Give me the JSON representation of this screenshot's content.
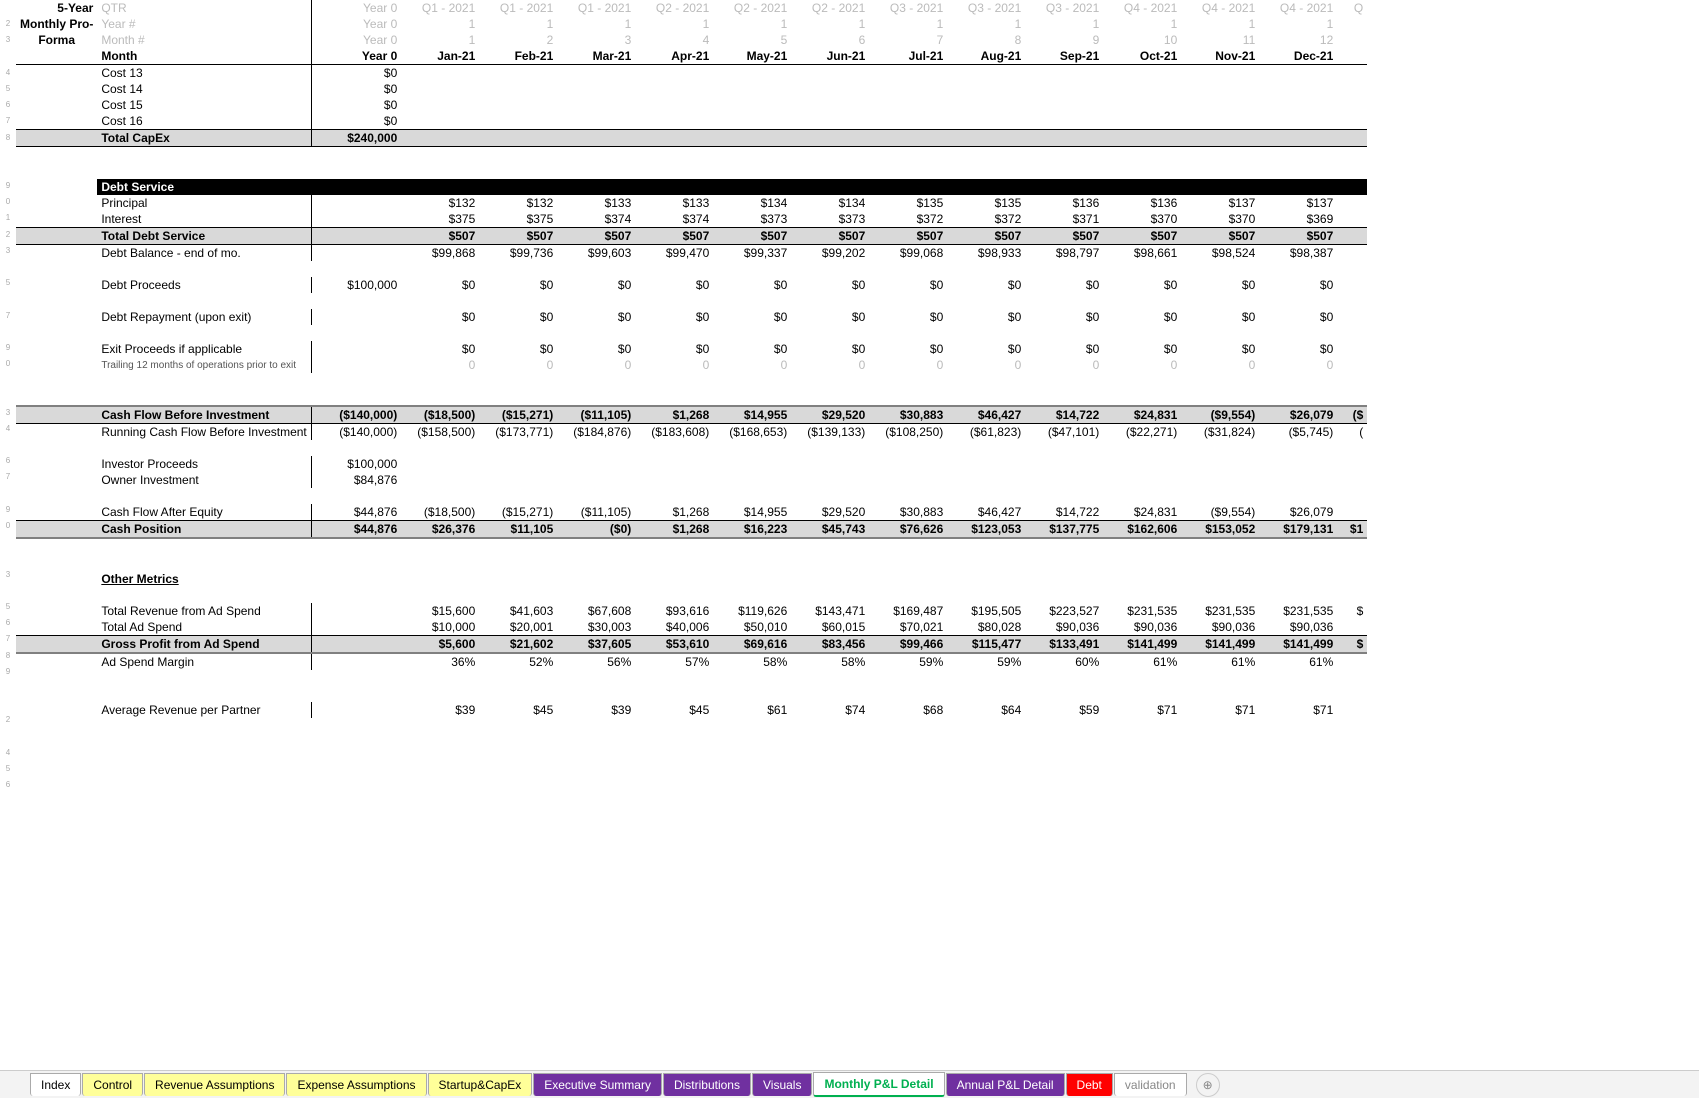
{
  "header": {
    "title_a": "5-Year",
    "title_b1": "Monthly Pro-",
    "title_b2": "Forma",
    "qtr_label": "QTR",
    "year_num_label": "Year #",
    "month_num_label": "Month #",
    "month_label": "Month",
    "year0": "Year 0",
    "quarters": [
      "Q1 - 2021",
      "Q1 - 2021",
      "Q1 - 2021",
      "Q2 - 2021",
      "Q2 - 2021",
      "Q2 - 2021",
      "Q3 - 2021",
      "Q3 - 2021",
      "Q3 - 2021",
      "Q4 - 2021",
      "Q4 - 2021",
      "Q4 - 2021",
      "Q"
    ],
    "year_nums": [
      "1",
      "1",
      "1",
      "1",
      "1",
      "1",
      "1",
      "1",
      "1",
      "1",
      "1",
      "1"
    ],
    "month_nums": [
      "1",
      "2",
      "3",
      "4",
      "5",
      "6",
      "7",
      "8",
      "9",
      "10",
      "11",
      "12"
    ],
    "months": [
      "Jan-21",
      "Feb-21",
      "Mar-21",
      "Apr-21",
      "May-21",
      "Jun-21",
      "Jul-21",
      "Aug-21",
      "Sep-21",
      "Oct-21",
      "Nov-21",
      "Dec-21"
    ]
  },
  "costs": {
    "c13": {
      "label": "Cost 13",
      "val": "$0"
    },
    "c14": {
      "label": "Cost 14",
      "val": "$0"
    },
    "c15": {
      "label": "Cost 15",
      "val": "$0"
    },
    "c16": {
      "label": "Cost 16",
      "val": "$0"
    },
    "total": {
      "label": "Total CapEx",
      "val": "$240,000"
    }
  },
  "debt": {
    "section": "Debt Service",
    "principal": {
      "label": "Principal",
      "vals": [
        "$132",
        "$132",
        "$133",
        "$133",
        "$134",
        "$134",
        "$135",
        "$135",
        "$136",
        "$136",
        "$137",
        "$137"
      ]
    },
    "interest": {
      "label": "Interest",
      "vals": [
        "$375",
        "$375",
        "$374",
        "$374",
        "$373",
        "$373",
        "$372",
        "$372",
        "$371",
        "$370",
        "$370",
        "$369"
      ]
    },
    "total": {
      "label": "Total Debt Service",
      "vals": [
        "$507",
        "$507",
        "$507",
        "$507",
        "$507",
        "$507",
        "$507",
        "$507",
        "$507",
        "$507",
        "$507",
        "$507"
      ]
    },
    "balance": {
      "label": "Debt Balance - end of mo.",
      "vals": [
        "$99,868",
        "$99,736",
        "$99,603",
        "$99,470",
        "$99,337",
        "$99,202",
        "$99,068",
        "$98,933",
        "$98,797",
        "$98,661",
        "$98,524",
        "$98,387"
      ]
    },
    "proceeds": {
      "label": "Debt Proceeds",
      "y0": "$100,000",
      "vals": [
        "$0",
        "$0",
        "$0",
        "$0",
        "$0",
        "$0",
        "$0",
        "$0",
        "$0",
        "$0",
        "$0",
        "$0"
      ]
    },
    "repay": {
      "label": "Debt Repayment (upon exit)",
      "vals": [
        "$0",
        "$0",
        "$0",
        "$0",
        "$0",
        "$0",
        "$0",
        "$0",
        "$0",
        "$0",
        "$0",
        "$0"
      ]
    },
    "exit": {
      "label": "Exit Proceeds if applicable",
      "vals": [
        "$0",
        "$0",
        "$0",
        "$0",
        "$0",
        "$0",
        "$0",
        "$0",
        "$0",
        "$0",
        "$0",
        "$0"
      ]
    },
    "trailing": {
      "label": "Trailing 12 months of operations prior to exit",
      "vals": [
        "0",
        "0",
        "0",
        "0",
        "0",
        "0",
        "0",
        "0",
        "0",
        "0",
        "0",
        "0"
      ]
    }
  },
  "cashflow": {
    "before": {
      "label": "Cash Flow Before Investment",
      "y0": "($140,000)",
      "vals": [
        "($18,500)",
        "($15,271)",
        "($11,105)",
        "$1,268",
        "$14,955",
        "$29,520",
        "$30,883",
        "$46,427",
        "$14,722",
        "$24,831",
        "($9,554)",
        "$26,079",
        "($"
      ]
    },
    "running": {
      "label": "Running Cash Flow Before Investment",
      "y0": "($140,000)",
      "vals": [
        "($158,500)",
        "($173,771)",
        "($184,876)",
        "($183,608)",
        "($168,653)",
        "($139,133)",
        "($108,250)",
        "($61,823)",
        "($47,101)",
        "($22,271)",
        "($31,824)",
        "($5,745)",
        "("
      ]
    },
    "investor": {
      "label": "Investor Proceeds",
      "y0": "$100,000"
    },
    "owner": {
      "label": "Owner Investment",
      "y0": "$84,876"
    },
    "after": {
      "label": "Cash Flow After Equity",
      "y0": "$44,876",
      "vals": [
        "($18,500)",
        "($15,271)",
        "($11,105)",
        "$1,268",
        "$14,955",
        "$29,520",
        "$30,883",
        "$46,427",
        "$14,722",
        "$24,831",
        "($9,554)",
        "$26,079"
      ]
    },
    "position": {
      "label": "Cash Position",
      "y0": "$44,876",
      "vals": [
        "$26,376",
        "$11,105",
        "($0)",
        "$1,268",
        "$16,223",
        "$45,743",
        "$76,626",
        "$123,053",
        "$137,775",
        "$162,606",
        "$153,052",
        "$179,131",
        "$1"
      ]
    }
  },
  "metrics": {
    "section": "Other Metrics",
    "rev": {
      "label": "Total Revenue from Ad Spend",
      "vals": [
        "$15,600",
        "$41,603",
        "$67,608",
        "$93,616",
        "$119,626",
        "$143,471",
        "$169,487",
        "$195,505",
        "$223,527",
        "$231,535",
        "$231,535",
        "$231,535",
        "$"
      ]
    },
    "spend": {
      "label": "Total Ad Spend",
      "vals": [
        "$10,000",
        "$20,001",
        "$30,003",
        "$40,006",
        "$50,010",
        "$60,015",
        "$70,021",
        "$80,028",
        "$90,036",
        "$90,036",
        "$90,036",
        "$90,036"
      ]
    },
    "gross": {
      "label": "Gross Profit from Ad Spend",
      "vals": [
        "$5,600",
        "$21,602",
        "$37,605",
        "$53,610",
        "$69,616",
        "$83,456",
        "$99,466",
        "$115,477",
        "$133,491",
        "$141,499",
        "$141,499",
        "$141,499",
        "$"
      ]
    },
    "margin": {
      "label": "Ad Spend Margin",
      "vals": [
        "36%",
        "52%",
        "56%",
        "57%",
        "58%",
        "58%",
        "59%",
        "59%",
        "60%",
        "61%",
        "61%",
        "61%"
      ]
    },
    "avg": {
      "label": "Average Revenue per Partner",
      "vals": [
        "$39",
        "$45",
        "$39",
        "$45",
        "$61",
        "$74",
        "$68",
        "$64",
        "$59",
        "$71",
        "$71",
        "$71"
      ]
    }
  },
  "tabs": [
    "Index",
    "Control",
    "Revenue Assumptions",
    "Expense Assumptions",
    "Startup&CapEx",
    "Executive Summary",
    "Distributions",
    "Visuals",
    "Monthly P&L Detail",
    "Annual P&L Detail",
    "Debt",
    "validation"
  ],
  "chart_data": {
    "type": "table",
    "description": "Financial spreadsheet — Monthly P&L Detail sheet. No plotted chart, tabular data only."
  }
}
